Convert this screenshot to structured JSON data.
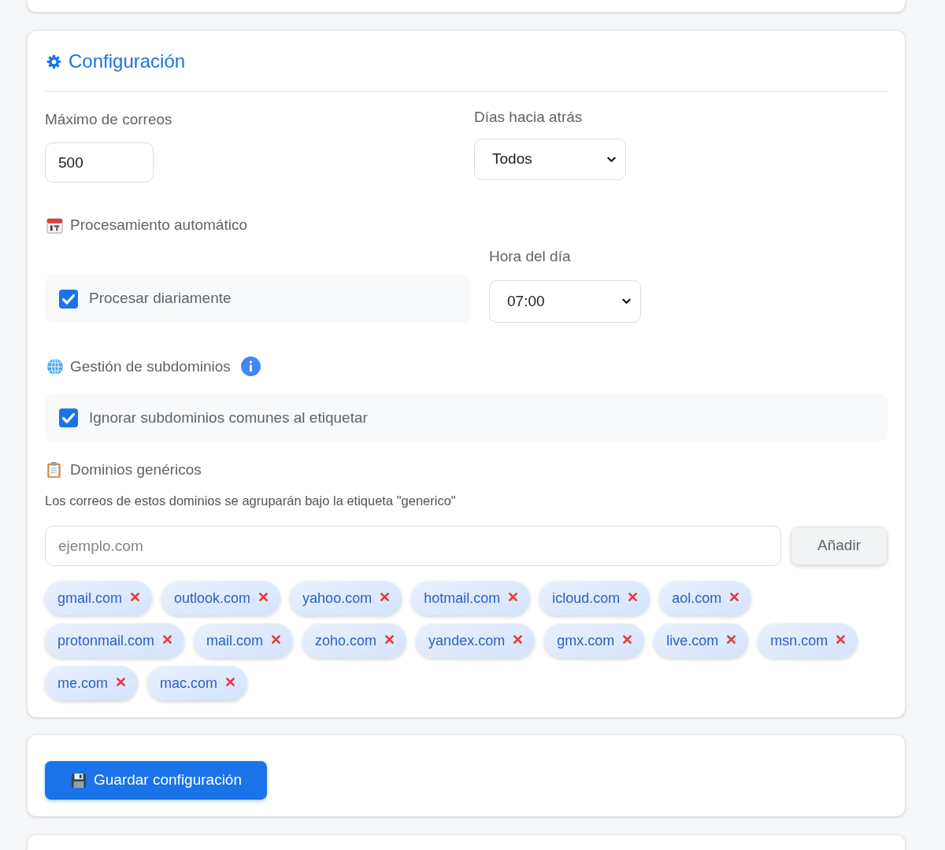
{
  "configuration": {
    "title": "Configuración",
    "max_emails": {
      "label": "Máximo de correos",
      "value": "500"
    },
    "days_back": {
      "label": "Días hacia atrás",
      "value": "Todos"
    },
    "auto_processing": {
      "heading": "Procesamiento automático",
      "daily": {
        "label": "Procesar diariamente",
        "checked": true
      },
      "time_of_day": {
        "label": "Hora del día",
        "value": "07:00"
      }
    },
    "subdomains": {
      "heading": "Gestión de subdominios",
      "ignore_common": {
        "label": "Ignorar subdominios comunes al etiquetar",
        "checked": true
      }
    },
    "generic_domains": {
      "heading": "Dominios genéricos",
      "description": "Los correos de estos dominios se agruparán bajo la etiqueta \"generico\"",
      "domain_input": {
        "placeholder": "ejemplo.com"
      },
      "add_button": "Añadir",
      "tags": [
        "gmail.com",
        "outlook.com",
        "yahoo.com",
        "hotmail.com",
        "icloud.com",
        "aol.com",
        "protonmail.com",
        "mail.com",
        "zoho.com",
        "yandex.com",
        "gmx.com",
        "live.com",
        "msn.com",
        "me.com",
        "mac.com"
      ]
    }
  },
  "save_button": {
    "label": "Guardar configuración"
  }
}
